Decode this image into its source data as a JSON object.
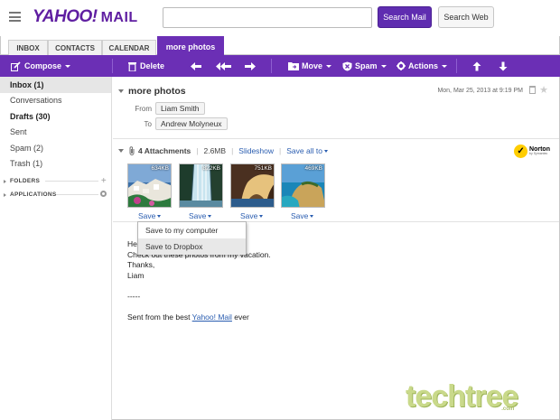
{
  "header": {
    "logo_yahoo": "YAHOO!",
    "logo_mail": "MAIL",
    "search_placeholder": "",
    "search_mail_label": "Search Mail",
    "search_web_label": "Search Web"
  },
  "tabs": [
    {
      "label": "INBOX"
    },
    {
      "label": "CONTACTS"
    },
    {
      "label": "CALENDAR"
    },
    {
      "label": "more photos"
    }
  ],
  "toolbar": {
    "compose": "Compose",
    "delete": "Delete",
    "move": "Move",
    "spam": "Spam",
    "actions": "Actions"
  },
  "sidebar": {
    "items": [
      {
        "label": "Inbox (1)"
      },
      {
        "label": "Conversations"
      },
      {
        "label": "Drafts (30)"
      },
      {
        "label": "Sent"
      },
      {
        "label": "Spam (2)"
      },
      {
        "label": "Trash (1)"
      }
    ],
    "folders": "FOLDERS",
    "applications": "APPLICATIONS"
  },
  "message": {
    "subject": "more photos",
    "date": "Mon, Mar 25, 2013 at 9:19 PM",
    "from_label": "From",
    "from": "Liam Smith",
    "to_label": "To",
    "to": "Andrew Molyneux",
    "attachments": {
      "count": "4 Attachments",
      "size": "2.6MB",
      "slideshow": "Slideshow",
      "save_all": "Save all to",
      "norton": "Norton",
      "norton_sub": "by Symantec",
      "files": [
        {
          "size": "634KB",
          "save": "Save"
        },
        {
          "size": "822KB",
          "save": "Save"
        },
        {
          "size": "751KB",
          "save": "Save"
        },
        {
          "size": "469KB",
          "save": "Save"
        }
      ]
    },
    "save_menu": [
      "Save to my computer",
      "Save to Dropbox"
    ],
    "body": {
      "greeting": "Hey,",
      "line1": "Check out these photos from my vacation.",
      "line2": "Thanks,",
      "line3": "Liam",
      "sig_sep": "-----",
      "sig_prefix": "Sent from the best ",
      "sig_link": "Yahoo! Mail",
      "sig_suffix": " ever"
    }
  },
  "watermark": {
    "text": "techtree",
    "sub": ".com"
  }
}
